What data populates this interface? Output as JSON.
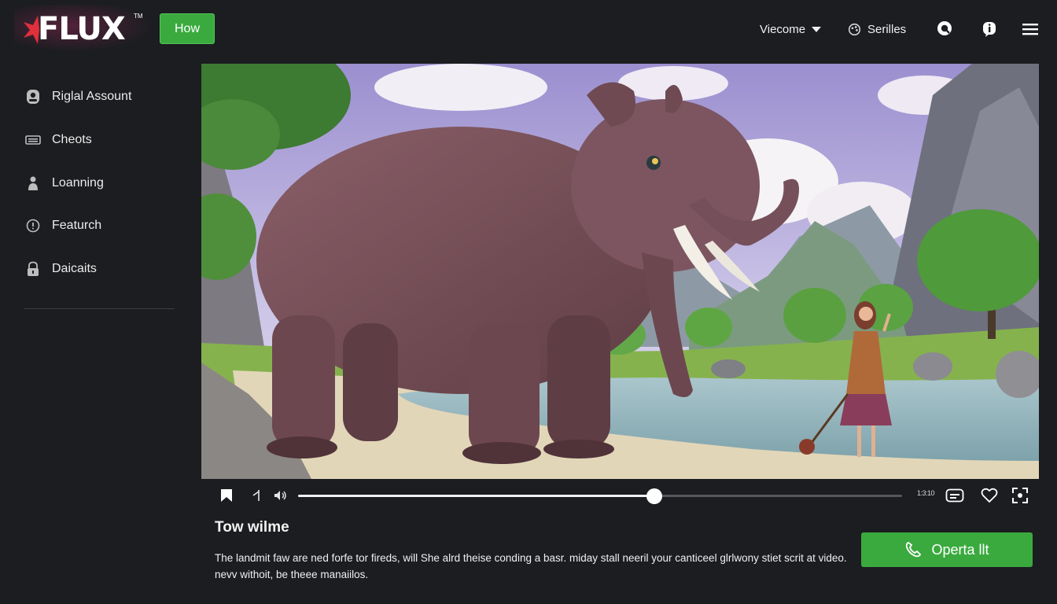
{
  "header": {
    "logo_text": "FLUX",
    "logo_tm": "TM",
    "how_label": "How",
    "welcome_label": "Viecome",
    "series_label": "Serilles",
    "icons": [
      "search-icon",
      "info-icon",
      "menu-icon"
    ]
  },
  "sidebar": {
    "items": [
      {
        "label": "Riglal Assount",
        "icon": "user-icon"
      },
      {
        "label": "Cheots",
        "icon": "keyboard-icon"
      },
      {
        "label": "Loanning",
        "icon": "person-icon"
      },
      {
        "label": "Featurch",
        "icon": "clock-icon"
      },
      {
        "label": "Daicaits",
        "icon": "lock-icon"
      }
    ]
  },
  "player": {
    "scene": "giant-pink-elephant-and-woman-by-lake",
    "progress": 0.59,
    "time_text": "1:3:10",
    "icons": [
      "skip-back-icon",
      "step-icon",
      "volume-icon",
      "subtitles-icon",
      "heart-icon",
      "fullscreen-icon"
    ]
  },
  "video": {
    "title": "Tow wilme",
    "description": "The landmit faw are ned forfe tor fireds, will She alrd theise conding a basr. miday stall neeril your canticeel glrlwony stiet scrit at video. nevv withoit, be theee manaiilos."
  },
  "cta": {
    "label": "Operta llt",
    "icon": "phone-icon"
  },
  "colors": {
    "background": "#1b1d20",
    "accent_green": "#3aaa3e",
    "logo_red": "#e0303c"
  }
}
